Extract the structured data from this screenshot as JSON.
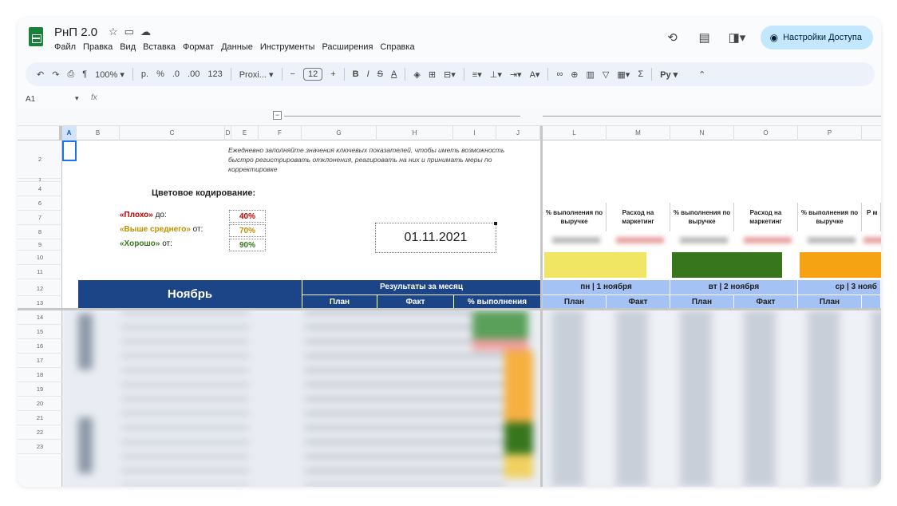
{
  "header": {
    "doc_title": "РнП 2.0",
    "menu": [
      "Файл",
      "Правка",
      "Вид",
      "Вставка",
      "Формат",
      "Данные",
      "Инструменты",
      "Расширения",
      "Справка"
    ],
    "share_label": "Настройки Доступа"
  },
  "toolbar": {
    "zoom": "100%",
    "currency": "р.",
    "percent": "%",
    "dec_decrease": ".0",
    "dec_increase": ".00",
    "number_format": "123",
    "font": "Proxi...",
    "font_size": "12",
    "bold": "B",
    "italic": "I",
    "text_color": "A",
    "input_tools": "Py"
  },
  "formula_bar": {
    "cell_ref": "A1",
    "fx": "fx"
  },
  "grid": {
    "columns": [
      "A",
      "B",
      "C",
      "D",
      "E",
      "F",
      "G",
      "H",
      "I",
      "J",
      "L",
      "M",
      "N",
      "O",
      "P"
    ],
    "rows": [
      "2",
      "3",
      "4",
      "6",
      "7",
      "8",
      "9",
      "10",
      "11",
      "12",
      "13",
      "14",
      "15",
      "16",
      "17",
      "18",
      "19",
      "20",
      "21",
      "22",
      "23"
    ]
  },
  "sheet": {
    "note": "Ежедневно заполняйте значения ключевых показателей, чтобы иметь возможность быстро регистрировать отклонения, реагировать на них и принимать меры по корректировке",
    "color_coding_title": "Цветовое кодирование:",
    "legend": [
      {
        "label": "«Плохо»",
        "suffix": " до:",
        "value": "40%",
        "color": "#c00000"
      },
      {
        "label": "«Выше среднего»",
        "suffix": " от:",
        "value": "70%",
        "color": "#bf9000"
      },
      {
        "label": "«Хорошо»",
        "suffix": " от:",
        "value": "90%",
        "color": "#38761d"
      }
    ],
    "date": "01.11.2021",
    "month": "Ноябрь",
    "results_title": "Результаты за месяц",
    "results_cols": [
      "План",
      "Факт",
      "% выполнения"
    ],
    "kpi_headers": [
      "% выполнения по выручке",
      "Расход на маркетинг",
      "% выполнения по выручке",
      "Расход на маркетинг",
      "% выполнения по выручке",
      "Р м"
    ],
    "days": [
      "пн | 1 ноября",
      "вт | 2 ноября",
      "ср | 3 нояб"
    ],
    "day_cols": [
      "План",
      "Факт",
      "План",
      "Факт",
      "План"
    ],
    "colors": {
      "navy": "#1c4587",
      "light_blue": "#a4c2f4",
      "yellow": "#f0e664",
      "green": "#38761d",
      "orange": "#f6a313"
    }
  }
}
